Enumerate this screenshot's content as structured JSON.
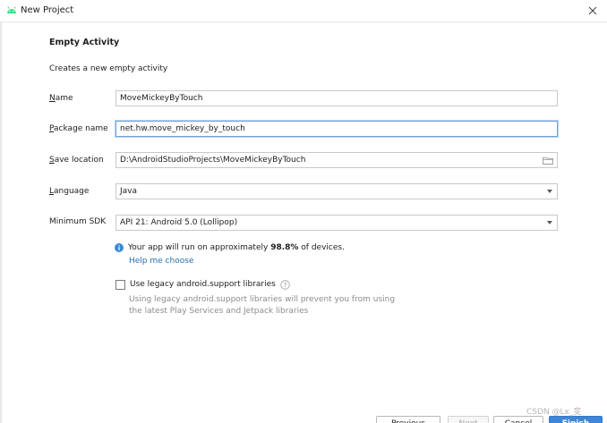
{
  "window": {
    "title": "New Project"
  },
  "page": {
    "heading": "Empty Activity",
    "subheading": "Creates a new empty activity"
  },
  "form": {
    "name": {
      "label_mnemonic": "N",
      "label_rest": "ame",
      "value": "MoveMickeyByTouch"
    },
    "package": {
      "label_mnemonic": "P",
      "label_rest": "ackage name",
      "value": "net.hw.move_mickey_by_touch"
    },
    "save_location": {
      "label_mnemonic": "S",
      "label_rest": "ave location",
      "value": "D:\\AndroidStudioProjects\\MoveMickeyByTouch",
      "icon": "folder-icon"
    },
    "language": {
      "label_mnemonic": "L",
      "label_rest": "anguage",
      "value": "Java"
    },
    "min_sdk": {
      "label": "Minimum SDK",
      "value": "API 21: Android 5.0 (Lollipop)"
    }
  },
  "info": {
    "prefix": "Your app will run on approximately ",
    "percent": "98.8%",
    "suffix": " of devices.",
    "help_link": "Help me choose",
    "icon": "info-icon"
  },
  "legacy": {
    "checked": false,
    "label": "Use legacy android.support libraries",
    "desc_line1": "Using legacy android.support libraries will prevent you from using",
    "desc_line2": "the latest Play Services and Jetpack libraries"
  },
  "buttons": {
    "previous": "Previous",
    "next": "Next",
    "cancel": "Cancel",
    "finish": "Finish"
  },
  "watermark": "CSDN @Lx_变",
  "colors": {
    "accent": "#3e87d8",
    "link": "#2470b3",
    "focus_border": "#6fa0db",
    "muted_text": "#8c8c8c"
  }
}
